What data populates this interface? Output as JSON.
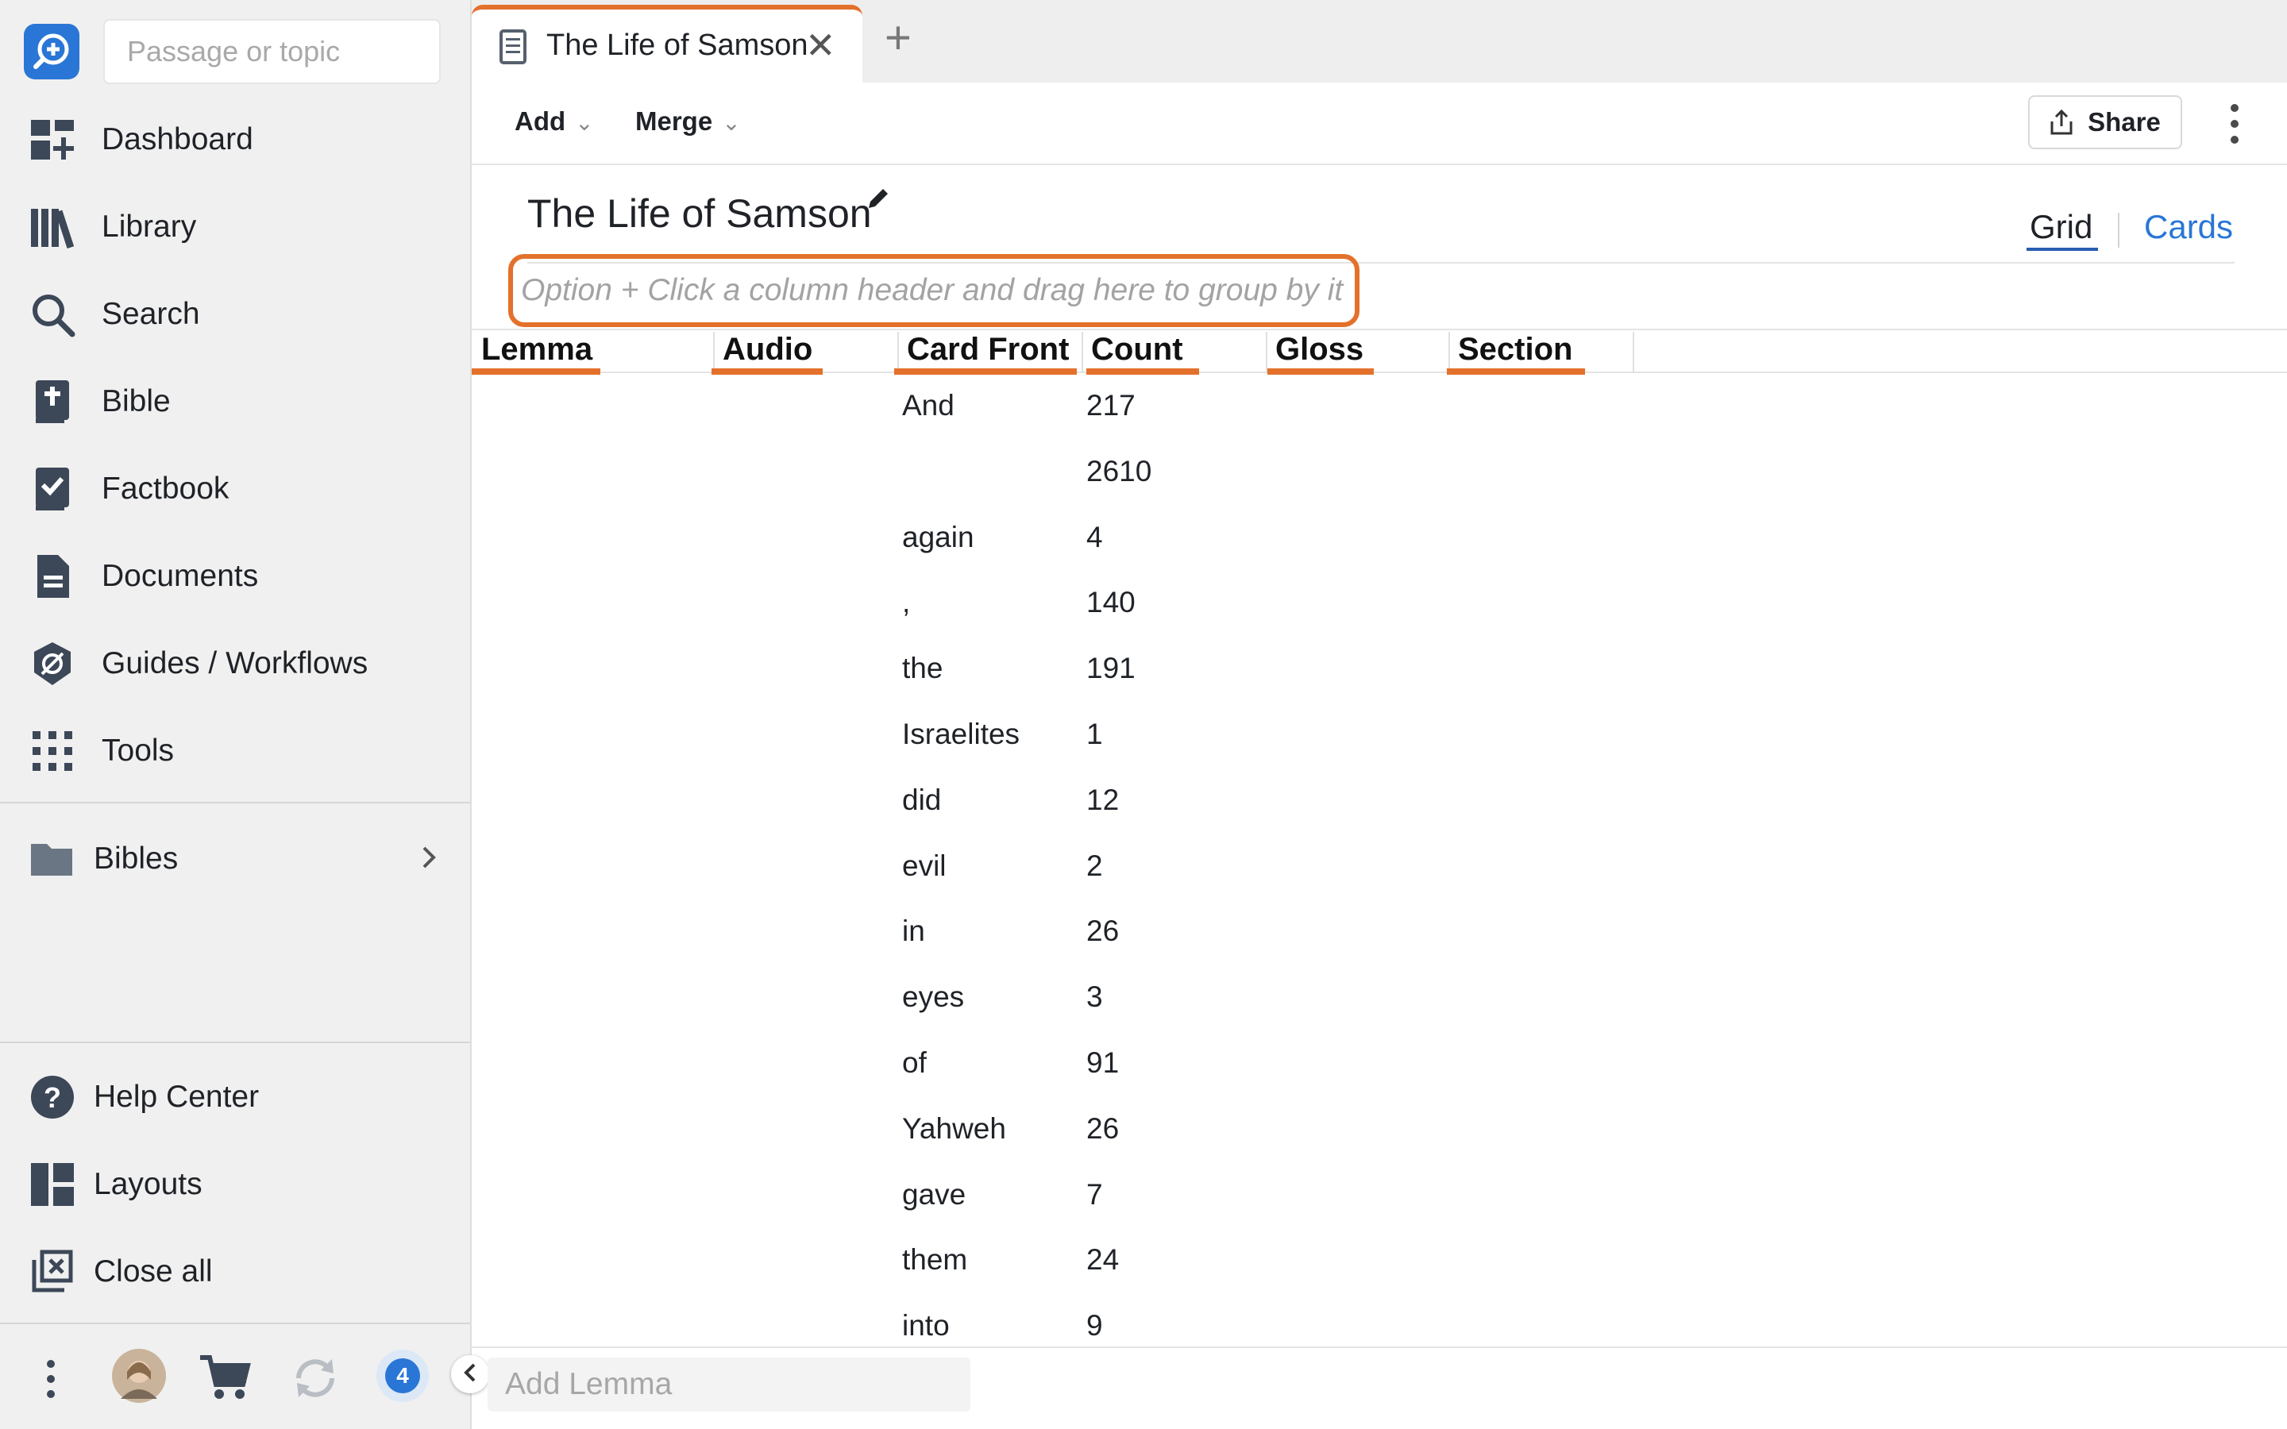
{
  "sidebar": {
    "search_placeholder": "Passage or topic",
    "nav": [
      {
        "label": "Dashboard",
        "icon": "dashboard-icon"
      },
      {
        "label": "Library",
        "icon": "library-icon"
      },
      {
        "label": "Search",
        "icon": "search-icon"
      },
      {
        "label": "Bible",
        "icon": "bible-icon"
      },
      {
        "label": "Factbook",
        "icon": "factbook-icon"
      },
      {
        "label": "Documents",
        "icon": "documents-icon"
      },
      {
        "label": "Guides / Workflows",
        "icon": "guides-icon"
      },
      {
        "label": "Tools",
        "icon": "tools-icon"
      }
    ],
    "folder": {
      "label": "Bibles",
      "icon": "folder-icon"
    },
    "bottom_nav": [
      {
        "label": "Help Center",
        "icon": "help-icon"
      },
      {
        "label": "Layouts",
        "icon": "layouts-icon"
      },
      {
        "label": "Close all",
        "icon": "close-all-icon"
      }
    ],
    "notification_count": "4"
  },
  "tabs": [
    {
      "title": "The Life of Samson",
      "icon": "document-icon",
      "active": true
    }
  ],
  "toolbar": {
    "add_label": "Add",
    "merge_label": "Merge",
    "share_label": "Share"
  },
  "document": {
    "title": "The Life of Samson",
    "views": {
      "grid": "Grid",
      "cards": "Cards",
      "active": "Grid"
    },
    "group_hint": "Option + Click a column header and drag here to group by it"
  },
  "grid": {
    "columns": [
      "Lemma",
      "Audio",
      "Card Front",
      "Count",
      "Gloss",
      "Section"
    ],
    "rows": [
      {
        "card_front": "And",
        "count": "217"
      },
      {
        "card_front": "",
        "count": "2610"
      },
      {
        "card_front": "again",
        "count": "4"
      },
      {
        "card_front": ",",
        "count": "140"
      },
      {
        "card_front": "the",
        "count": "191"
      },
      {
        "card_front": "Israelites",
        "count": "1"
      },
      {
        "card_front": "did",
        "count": "12"
      },
      {
        "card_front": "evil",
        "count": "2"
      },
      {
        "card_front": "in",
        "count": "26"
      },
      {
        "card_front": "eyes",
        "count": "3"
      },
      {
        "card_front": "of",
        "count": "91"
      },
      {
        "card_front": "Yahweh",
        "count": "26"
      },
      {
        "card_front": "gave",
        "count": "7"
      },
      {
        "card_front": "them",
        "count": "24"
      },
      {
        "card_front": "into",
        "count": "9"
      }
    ],
    "add_placeholder": "Add Lemma"
  },
  "colors": {
    "accent": "#e3702b",
    "link": "#2a76d6",
    "sidebar_bg": "#f0f0f0"
  }
}
